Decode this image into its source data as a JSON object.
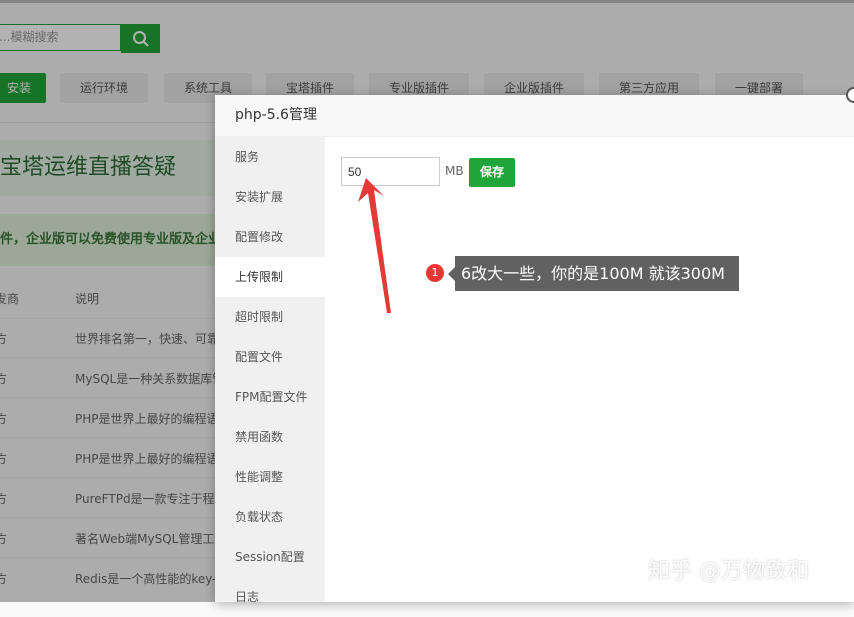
{
  "background": {
    "search_placeholder": "...模糊搜索",
    "categories": [
      {
        "label": "安装",
        "active": true
      },
      {
        "label": "运行环境",
        "active": false
      },
      {
        "label": "系统工具",
        "active": false
      },
      {
        "label": "宝塔插件",
        "active": false
      },
      {
        "label": "专业版插件",
        "active": false
      },
      {
        "label": "企业版插件",
        "active": false
      },
      {
        "label": "第三方应用",
        "active": false
      },
      {
        "label": "一键部署",
        "active": false
      }
    ],
    "banner": "宝塔运维直播答疑",
    "notice": "件，企业版可以免费使用专业版及企业版",
    "table_headers": {
      "vendor": "发商",
      "description": "说明"
    },
    "rows": [
      {
        "vendor": "方",
        "description": "世界排名第一，快速、可靠"
      },
      {
        "vendor": "方",
        "description": "MySQL是一种关系数据库管理"
      },
      {
        "vendor": "方",
        "description": "PHP是世界上最好的编程语言"
      },
      {
        "vendor": "方",
        "description": "PHP是世界上最好的编程语言"
      },
      {
        "vendor": "方",
        "description": "PureFTPd是一款专注于程序"
      },
      {
        "vendor": "方",
        "description": "著名Web端MySQL管理工具"
      },
      {
        "vendor": "方",
        "description": "Redis是一个高性能的key-value"
      }
    ]
  },
  "modal": {
    "title": "php-5.6管理",
    "menu": [
      {
        "label": "服务",
        "active": false
      },
      {
        "label": "安装扩展",
        "active": false
      },
      {
        "label": "配置修改",
        "active": false
      },
      {
        "label": "上传限制",
        "active": true
      },
      {
        "label": "超时限制",
        "active": false
      },
      {
        "label": "配置文件",
        "active": false
      },
      {
        "label": "FPM配置文件",
        "active": false
      },
      {
        "label": "禁用函数",
        "active": false
      },
      {
        "label": "性能调整",
        "active": false
      },
      {
        "label": "负载状态",
        "active": false
      },
      {
        "label": "Session配置",
        "active": false
      },
      {
        "label": "日志",
        "active": false
      }
    ],
    "upload_limit_value": "50",
    "unit": "MB",
    "save_label": "保存"
  },
  "annotation": {
    "number": "1",
    "text": "6改大一些，你的是100M  就该300M",
    "color": "#e53935"
  },
  "watermark": "知乎 @万物致和",
  "colors": {
    "brand_green": "#20a53a",
    "tooltip_bg": "#616161"
  }
}
